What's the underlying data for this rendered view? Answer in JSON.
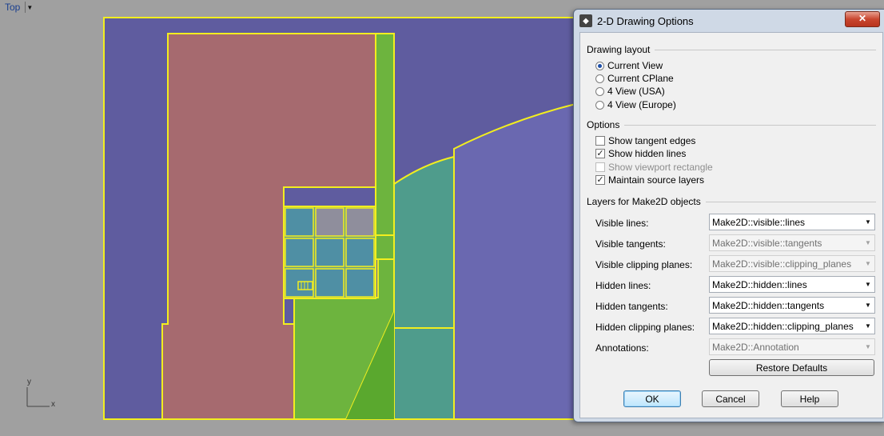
{
  "viewport": {
    "name": "Top",
    "axes": {
      "x": "x",
      "y": "y"
    }
  },
  "dialog": {
    "title": "2-D Drawing Options",
    "close_glyph": "✕",
    "drawing_layout": {
      "heading": "Drawing layout",
      "options": [
        {
          "label": "Current View",
          "selected": true
        },
        {
          "label": "Current CPlane",
          "selected": false
        },
        {
          "label": "4 View (USA)",
          "selected": false
        },
        {
          "label": "4 View (Europe)",
          "selected": false
        }
      ]
    },
    "options": {
      "heading": "Options",
      "checks": [
        {
          "label": "Show tangent edges",
          "checked": false,
          "enabled": true
        },
        {
          "label": "Show hidden lines",
          "checked": true,
          "enabled": true
        },
        {
          "label": "Show viewport rectangle",
          "checked": false,
          "enabled": false
        },
        {
          "label": "Maintain source layers",
          "checked": true,
          "enabled": true
        }
      ]
    },
    "layers": {
      "heading": "Layers for Make2D objects",
      "rows": [
        {
          "label": "Visible lines:",
          "value": "Make2D::visible::lines",
          "enabled": true
        },
        {
          "label": "Visible tangents:",
          "value": "Make2D::visible::tangents",
          "enabled": false
        },
        {
          "label": "Visible clipping planes:",
          "value": "Make2D::visible::clipping_planes",
          "enabled": false
        },
        {
          "label": "Hidden lines:",
          "value": "Make2D::hidden::lines",
          "enabled": true
        },
        {
          "label": "Hidden tangents:",
          "value": "Make2D::hidden::tangents",
          "enabled": true
        },
        {
          "label": "Hidden clipping planes:",
          "value": "Make2D::hidden::clipping_planes",
          "enabled": true
        },
        {
          "label": "Annotations:",
          "value": "Make2D::Annotation",
          "enabled": false
        }
      ]
    },
    "buttons": {
      "restore_defaults": "Restore Defaults",
      "ok": "OK",
      "cancel": "Cancel",
      "help": "Help"
    },
    "check_glyph": "✓",
    "dropdown_glyph": "▼"
  },
  "colors": {
    "outline": "#f2ee1f",
    "blue_face": "#5f5c9f",
    "red_face": "#a66a6f",
    "green_face": "#6db43e",
    "teal_face": "#4f9c8c",
    "cell_blue": "#4f8fa4",
    "cell_gray": "#8f8e9c"
  }
}
